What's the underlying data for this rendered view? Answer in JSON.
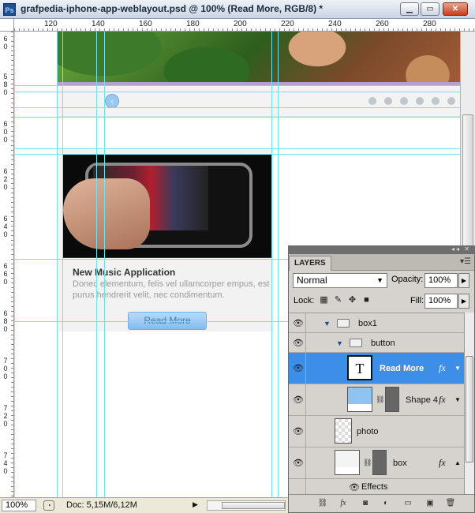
{
  "window": {
    "title": "grafpedia-iphone-app-weblayout.psd @ 100% (Read More, RGB/8) *",
    "app_icon": "Ps",
    "minimize_label": "▁",
    "restore_label": "▭",
    "close_label": "✕"
  },
  "ruler_top": [
    "120",
    "140",
    "160",
    "180",
    "200",
    "220",
    "240",
    "260",
    "280"
  ],
  "ruler_left": [
    "6 0",
    "5 8 0",
    "6 0 0",
    "6 2 0",
    "6 4 0",
    "6 6 0",
    "6 8 0",
    "7 0 0",
    "7 2 0",
    "7 4 0"
  ],
  "canvas": {
    "prev_arrow": "‹",
    "card_title": "New Music Application",
    "card_desc": "Donec elementum, felis vel ullamcorper empus, est purus hendrerit velit, nec condimentum.",
    "button_label": "Read More"
  },
  "status": {
    "zoom": "100%",
    "doc": "Doc: 5,15M/6,12M",
    "arrow": "▶"
  },
  "layers_panel": {
    "tab": "LAYERS",
    "blend_mode": "Normal",
    "opacity_label": "Opacity:",
    "opacity": "100%",
    "lock_label": "Lock:",
    "fill_label": "Fill:",
    "fill": "100%",
    "layers": [
      {
        "name": "box1",
        "type": "group"
      },
      {
        "name": "button",
        "type": "group"
      },
      {
        "name": "Read More",
        "type": "text",
        "fx": "fx",
        "selected": true
      },
      {
        "name": "Shape 4",
        "type": "shape",
        "fx": "fx"
      },
      {
        "name": "photo",
        "type": "pixel"
      },
      {
        "name": "box",
        "type": "shape",
        "fx": "fx"
      },
      {
        "name": "Effects",
        "type": "effects"
      }
    ],
    "footer_icons": [
      "link-icon",
      "fx-icon",
      "mask-icon",
      "adjustment-icon",
      "folder-icon",
      "new-layer-icon",
      "trash-icon"
    ]
  },
  "colors": {
    "guide": "#6fe3ee",
    "selected_layer": "#3d8ee6",
    "button_fill": "#8fc6f2"
  }
}
